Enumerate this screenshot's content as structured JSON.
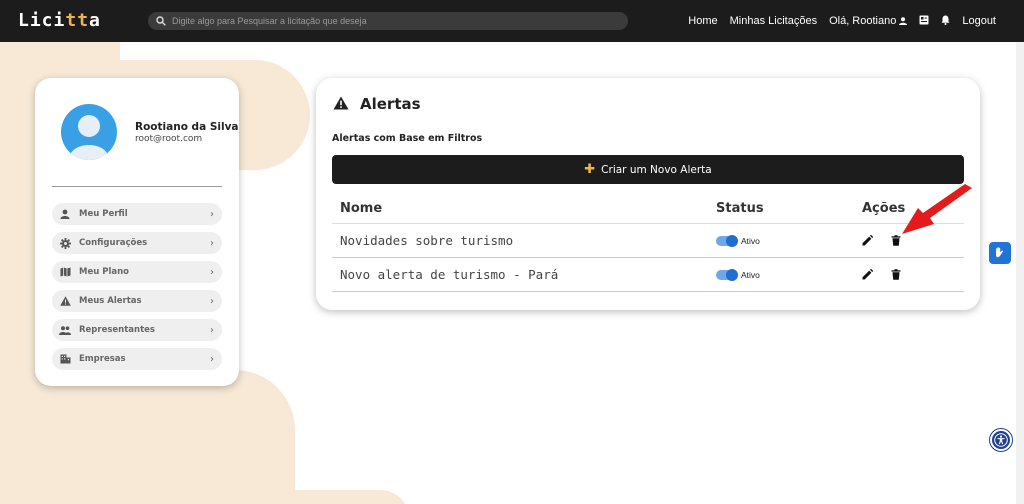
{
  "header": {
    "logo_prefix": "Lici",
    "logo_accent": "tt",
    "logo_suffix": "a",
    "search_placeholder": "Digite algo para Pesquisar a licitação que deseja",
    "nav": {
      "home": "Home",
      "minhas_licitacoes": "Minhas Licitações",
      "greeting": "Olá, Rootiano",
      "logout": "Logout"
    }
  },
  "profile": {
    "name": "Rootiano da Silva",
    "email": "root@root.com",
    "menu": [
      {
        "label": "Meu Perfil",
        "icon": "person-icon"
      },
      {
        "label": "Configurações",
        "icon": "gear-icon"
      },
      {
        "label": "Meu Plano",
        "icon": "map-icon"
      },
      {
        "label": "Meus Alertas",
        "icon": "warning-icon"
      },
      {
        "label": "Representantes",
        "icon": "group-icon"
      },
      {
        "label": "Empresas",
        "icon": "building-icon"
      }
    ]
  },
  "alerts": {
    "title": "Alertas",
    "subtitle": "Alertas com Base em Filtros",
    "create_button": "Criar um Novo Alerta",
    "columns": {
      "name": "Nome",
      "status": "Status",
      "actions": "Ações"
    },
    "rows": [
      {
        "name": "Novidades sobre turismo",
        "status": "Ativo",
        "active": true
      },
      {
        "name": "Novo alerta de turismo - Pará",
        "status": "Ativo",
        "active": true
      }
    ]
  },
  "colors": {
    "accent": "#f2b34a",
    "topbar": "#1c1c1c",
    "toggle": "#1f6fd1",
    "annotation_arrow": "#e31b1b",
    "background_shape": "#f7e9d6"
  }
}
